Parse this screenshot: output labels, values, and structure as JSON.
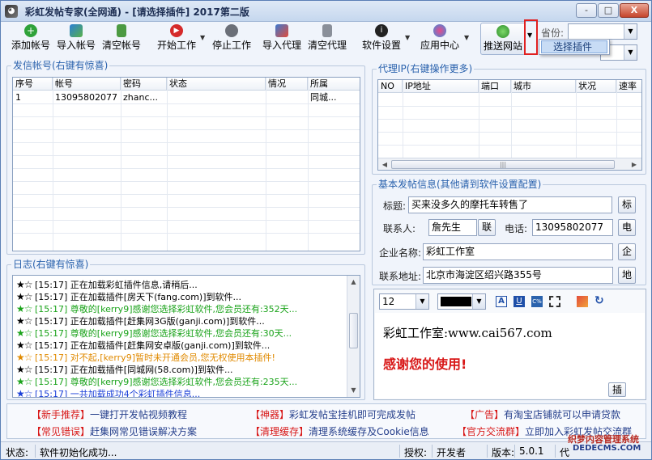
{
  "window": {
    "title": "彩虹发帖专家(全网通) - [请选择插件]   2017第二版",
    "min_label": "-",
    "max_label": "□",
    "close_label": "X"
  },
  "toolbar": {
    "add_account": "添加帐号",
    "import_account": "导入帐号",
    "clear_account": "清空帐号",
    "start_work": "开始工作",
    "stop_work": "停止工作",
    "import_proxy": "导入代理",
    "clear_proxy": "清空代理",
    "settings": "软件设置",
    "app_center": "应用中心",
    "push_site": "推送网站",
    "province_label": "省份:",
    "province_value": "",
    "second_select_value": ""
  },
  "popup": {
    "select_plugin": "选择插件"
  },
  "accounts": {
    "group_label": "发信帐号(右键有惊喜)",
    "columns": [
      "序号",
      "帐号",
      "密码",
      "状态",
      "情况",
      "所属"
    ],
    "rows": [
      [
        "1",
        "13095802077",
        "zhanc...",
        "",
        "",
        "同城..."
      ]
    ]
  },
  "proxy": {
    "group_label": "代理IP(右键操作更多)",
    "columns": [
      "NO",
      "IP地址",
      "端口",
      "城市",
      "状况",
      "速率"
    ],
    "scroll_grip": "|||"
  },
  "basic": {
    "group_label": "基本发帖信息(其他请到软件设置配置)",
    "title_label": "标题:",
    "title_value": "买来没多久的摩托车转售了",
    "title_btn": "标",
    "contact_label": "联系人:",
    "contact_value": "詹先生",
    "contact_btn": "联",
    "phone_label": "电话:",
    "phone_value": "13095802077",
    "phone_btn": "电",
    "company_label": "企业名称:",
    "company_value": "彩虹工作室",
    "company_btn": "企",
    "address_label": "联系地址:",
    "address_value": "北京市海淀区绍兴路355号",
    "address_btn": "地"
  },
  "editor": {
    "font_size": "12",
    "line1": "彩虹工作室:www.cai567.com",
    "line2": "感谢您的使用!",
    "insert_btn": "插",
    "icons": {
      "bold_color": "#1f4fa8",
      "text_color": "#000000",
      "accent": "#d81818"
    }
  },
  "log": {
    "group_label": "日志(右键有惊喜)",
    "lines": [
      {
        "stars": "★☆",
        "text": "[15:17] 正在加载彩虹插件信息,请稍后...",
        "color": "#000000"
      },
      {
        "stars": "★☆",
        "text": "[15:17] 正在加载插件[房天下(fang.com)]到软件...",
        "color": "#000000"
      },
      {
        "stars": "★☆",
        "text": "[15:17] 尊敬的[kerry9]感谢您选择彩虹软件,您会员还有:352天...",
        "color": "#1aa31a"
      },
      {
        "stars": "★☆",
        "text": "[15:17] 正在加载插件[赶集网3G版(ganji.com)]到软件...",
        "color": "#000000"
      },
      {
        "stars": "★☆",
        "text": "[15:17] 尊敬的[kerry9]感谢您选择彩虹软件,您会员还有:30天...",
        "color": "#1aa31a"
      },
      {
        "stars": "★☆",
        "text": "[15:17] 正在加载插件[赶集网安卓版(ganji.com)]到软件...",
        "color": "#000000"
      },
      {
        "stars": "★☆",
        "text": "[15:17] 对不起,[kerry9]暂时未开通会员,您无权使用本插件!",
        "color": "#e08a00"
      },
      {
        "stars": "★☆",
        "text": "[15:17] 正在加载插件[同城网(58.com)]到软件...",
        "color": "#000000"
      },
      {
        "stars": "★☆",
        "text": "[15:17] 尊敬的[kerry9]感谢您选择彩虹软件,您会员还有:235天...",
        "color": "#1aa31a"
      },
      {
        "stars": "★☆",
        "text": "[15:17] 一共加载成功4个彩虹插件信息...",
        "color": "#1a3fd8"
      }
    ],
    "star_colors": [
      "#000000",
      "#000000",
      "#1aa31a",
      "#000000",
      "#1aa31a",
      "#000000",
      "#e08a00",
      "#000000",
      "#1aa31a",
      "#1a3fd8"
    ]
  },
  "promos": [
    {
      "tag": "【新手推荐】",
      "text": "一键打开发帖视频教程"
    },
    {
      "tag": "【神器】",
      "text": "彩虹发帖宝挂机即可完成发帖"
    },
    {
      "tag": "【广告】",
      "text": "有淘宝店铺就可以申请贷款"
    },
    {
      "tag": "【常见错误】",
      "text": "赶集网常见错误解决方案"
    },
    {
      "tag": "【清理缓存】",
      "text": "清理系统缓存及Cookie信息"
    },
    {
      "tag": "【官方交流群】",
      "text": "立即加入彩虹发帖交流群"
    }
  ],
  "status": {
    "state_label": "状态:",
    "state_value": "软件初始化成功...",
    "auth_label": "授权:",
    "auth_value": "开发者",
    "version_label": "版本:",
    "version_value": "5.0.1",
    "extra_label": "代",
    "watermark": "织梦内容管理系统",
    "watermark_url": "DEDECMS.COM"
  }
}
